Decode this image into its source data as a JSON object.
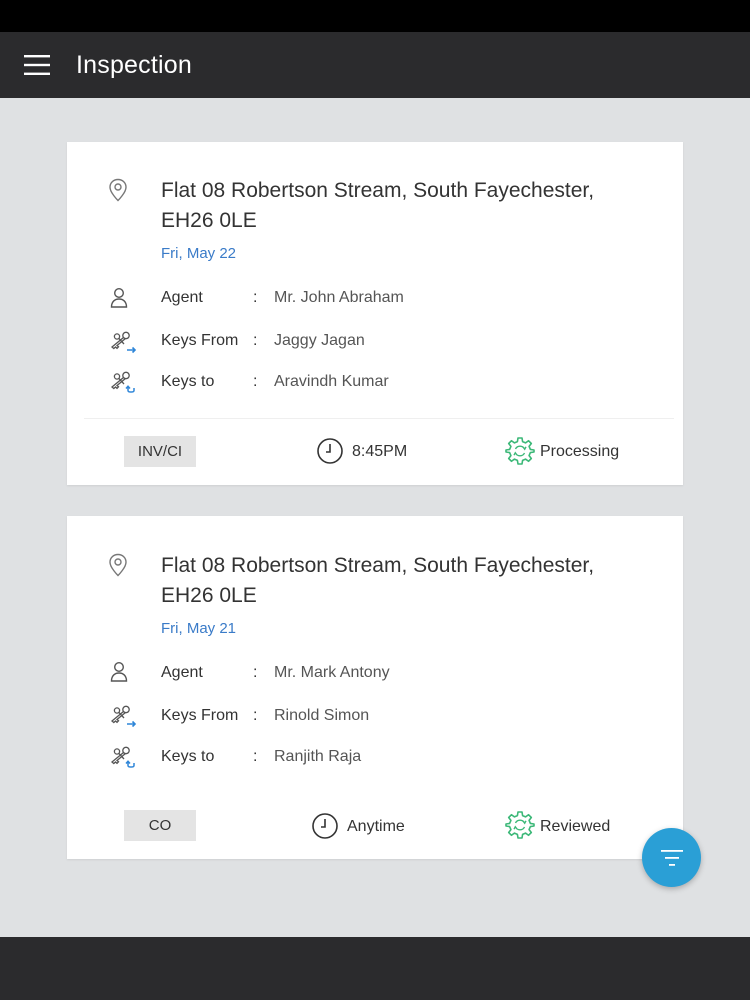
{
  "app": {
    "title": "Inspection",
    "icons": {
      "menu": "menu-icon",
      "filter": "filter-icon"
    },
    "colors": {
      "app_bar": "#2b2b2d",
      "date": "#3a7bc8",
      "status_icon": "#3cb878",
      "fab": "#2a9fd6"
    }
  },
  "inspections": [
    {
      "address": "Flat 08 Robertson Stream, South Fayechester, EH26 0LE",
      "address_line1": "Flat 08 Robertson Stream, South Fayechester,",
      "address_line2": "EH26 0LE",
      "date": "Fri, May 22",
      "rows": [
        {
          "label": "Agent",
          "colon": ":",
          "value": "Mr. John Abraham",
          "icon": "person-icon"
        },
        {
          "label": "Keys From",
          "colon": ":",
          "value": "Jaggy Jagan",
          "icon": "keys-from-icon"
        },
        {
          "label": "Keys to",
          "colon": ":",
          "value": "Aravindh Kumar",
          "icon": "keys-to-icon"
        }
      ],
      "type": "INV/CI",
      "time": "8:45PM",
      "status": "Processing"
    },
    {
      "address": "Flat 08 Robertson Stream, South Fayechester, EH26 0LE",
      "address_line1": "Flat 08 Robertson Stream, South Fayechester,",
      "address_line2": "EH26 0LE",
      "date": "Fri, May 21",
      "rows": [
        {
          "label": "Agent",
          "colon": ":",
          "value": "Mr. Mark Antony",
          "icon": "person-icon"
        },
        {
          "label": "Keys From",
          "colon": ":",
          "value": "Rinold Simon",
          "icon": "keys-from-icon"
        },
        {
          "label": "Keys to",
          "colon": ":",
          "value": "Ranjith Raja",
          "icon": "keys-to-icon"
        }
      ],
      "type": "CO",
      "time": "Anytime",
      "status": "Reviewed"
    }
  ]
}
